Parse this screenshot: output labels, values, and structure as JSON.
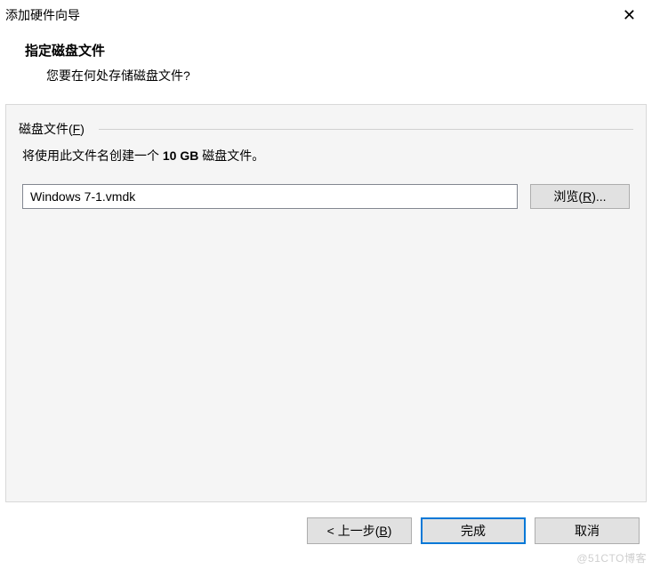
{
  "window": {
    "title": "添加硬件向导"
  },
  "header": {
    "title": "指定磁盘文件",
    "subtitle": "您要在何处存储磁盘文件?"
  },
  "content": {
    "fieldset_label_prefix": "磁盘文件(",
    "fieldset_label_underline": "F",
    "fieldset_label_suffix": ")",
    "desc_prefix": "将使用此文件名创建一个 ",
    "desc_bold": "10 GB",
    "desc_suffix": " 磁盘文件。",
    "filename_value": "Windows 7-1.vmdk",
    "browse_prefix": "浏览(",
    "browse_underline": "R",
    "browse_suffix": ")..."
  },
  "footer": {
    "back_prefix": "< 上一步(",
    "back_underline": "B",
    "back_suffix": ")",
    "finish": "完成",
    "cancel": "取消"
  },
  "watermark": "@51CTO博客"
}
